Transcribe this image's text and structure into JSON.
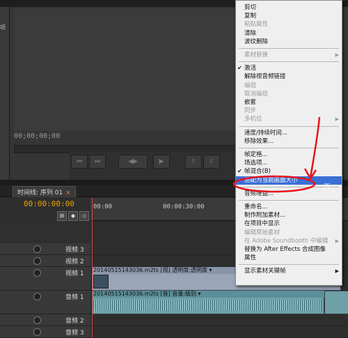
{
  "project_panel": {
    "tab_fragment": "项"
  },
  "program_monitor": {
    "timecode": "00;00;00;00"
  },
  "timeline": {
    "tab_label": "时间线: 序列 01",
    "tab_close": "×",
    "current_time": "00:00:00:00",
    "ruler_ticks": [
      "00:00",
      "00:00:30:00"
    ],
    "tracks": [
      {
        "name": "视频 3"
      },
      {
        "name": "视频 2"
      },
      {
        "name": "视频 1"
      },
      {
        "name": "音频 1"
      },
      {
        "name": "音频 2"
      },
      {
        "name": "音频 3"
      }
    ],
    "video_clip_label": "20140515143036.m2ts [视] 透明度:透明度 ▾",
    "audio_clip_label": "20140515143036.m2ts [音] 音量:级别 ▾"
  },
  "context_menu": {
    "items": [
      {
        "label": "剪切",
        "disabled": false
      },
      {
        "label": "复制",
        "disabled": false
      },
      {
        "label": "粘贴属性",
        "disabled": true
      },
      {
        "label": "清除",
        "disabled": false
      },
      {
        "label": "波纹删除",
        "disabled": false
      },
      {
        "sep": true
      },
      {
        "label": "素材替换",
        "disabled": true,
        "submenu": true
      },
      {
        "sep": true
      },
      {
        "label": "激活",
        "disabled": false,
        "checked": true
      },
      {
        "label": "解除视音频链接",
        "disabled": false
      },
      {
        "label": "编组",
        "disabled": true
      },
      {
        "label": "取消编组",
        "disabled": true
      },
      {
        "label": "嵌套",
        "disabled": false
      },
      {
        "label": "同步",
        "disabled": true
      },
      {
        "label": "多机位",
        "disabled": true,
        "submenu": true
      },
      {
        "sep": true
      },
      {
        "label": "速度/持续时间...",
        "disabled": false
      },
      {
        "label": "移除效果...",
        "disabled": false
      },
      {
        "sep": true
      },
      {
        "label": "帧定格...",
        "disabled": false
      },
      {
        "label": "场选项...",
        "disabled": false
      },
      {
        "label": "帧混合(B)",
        "disabled": false,
        "checked": true
      },
      {
        "label": "适配为当前画面大小",
        "disabled": false,
        "highlighted": true
      },
      {
        "sep": true
      },
      {
        "label": "音频增益...",
        "disabled": false
      },
      {
        "sep": true
      },
      {
        "label": "重命名...",
        "disabled": false
      },
      {
        "label": "制作附加素材...",
        "disabled": false
      },
      {
        "label": "在项目中显示",
        "disabled": false
      },
      {
        "label": "编辑原始素材",
        "disabled": true
      },
      {
        "label": "在 Adobe Soundbooth 中编辑",
        "disabled": true,
        "submenu": true
      },
      {
        "label": "替换为 After Effects 合成图像",
        "disabled": false
      },
      {
        "label": "属性",
        "disabled": false
      },
      {
        "sep": true
      },
      {
        "label": "显示素材关键帧",
        "disabled": false,
        "submenu": true
      }
    ]
  },
  "colors": {
    "highlight": "#3a6fd8",
    "annotation": "#e8141c",
    "timecode": "#e8a000"
  }
}
